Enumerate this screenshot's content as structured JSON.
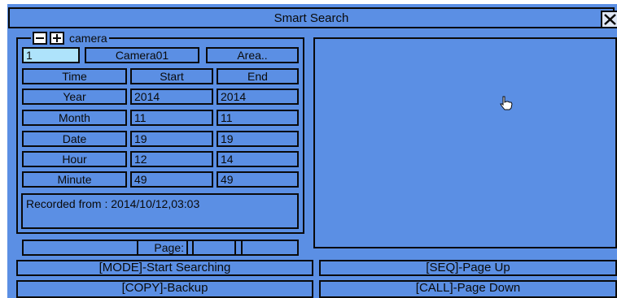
{
  "window": {
    "title": "Smart Search"
  },
  "camera_group": {
    "legend": "camera",
    "channel_value": "1",
    "camera_name": "Camera01",
    "area_label": "Area.."
  },
  "time_table": {
    "headers": {
      "time": "Time",
      "start": "Start",
      "end": "End"
    },
    "rows": [
      {
        "label": "Year",
        "start": "2014",
        "end": "2014"
      },
      {
        "label": "Month",
        "start": "11",
        "end": "11"
      },
      {
        "label": "Date",
        "start": "19",
        "end": "19"
      },
      {
        "label": "Hour",
        "start": "12",
        "end": "14"
      },
      {
        "label": "Minute",
        "start": "49",
        "end": "49"
      }
    ]
  },
  "recorded_from": "Recorded from : 2014/10/12,03:03",
  "pager": {
    "label": "Page:",
    "current": "",
    "total": ""
  },
  "footer": {
    "start_searching": "[MODE]-Start Searching",
    "page_up": "[SEQ]-Page Up",
    "backup": "[COPY]-Backup",
    "page_down": "[CALL]-Page Down"
  },
  "colors": {
    "background": "#5b8fe4",
    "selected_input": "#aee3fb",
    "border": "#0a0a0a"
  },
  "icons": {
    "close": "close-icon",
    "minus": "minus-icon",
    "plus": "plus-icon",
    "cursor": "hand-pointer-icon"
  }
}
